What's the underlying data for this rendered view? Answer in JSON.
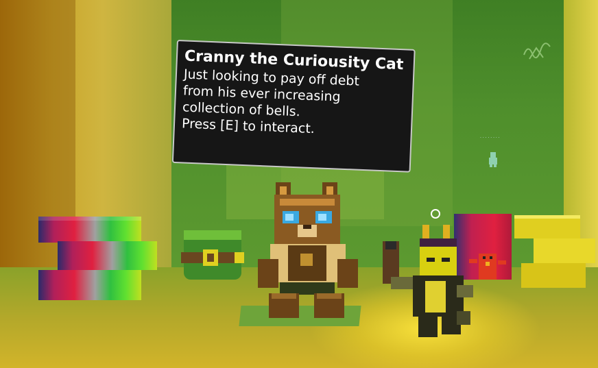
{
  "npc": {
    "name": "Cranny the Curiousity Cat",
    "description_lines": [
      "Just looking to pay off debt",
      "from his ever increasing",
      "collection of bells."
    ],
    "prompt": "Press [E] to interact."
  },
  "colors": {
    "dialog_bg": "#161616",
    "dialog_border": "#c8c8c8",
    "dialog_text": "#ffffff"
  },
  "icons": {
    "crosshair": "crosshair-icon"
  }
}
